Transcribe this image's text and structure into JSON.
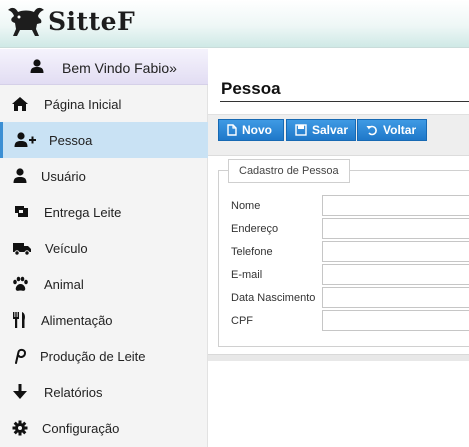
{
  "brand": {
    "name": "SitteF"
  },
  "sidebar": {
    "welcome": "Bem Vindo Fabio»",
    "items": [
      {
        "label": "Página Inicial",
        "icon": "home-icon"
      },
      {
        "label": "Pessoa",
        "icon": "user-plus-icon",
        "active": true
      },
      {
        "label": "Usuário",
        "icon": "user-icon"
      },
      {
        "label": "Entrega Leite",
        "icon": "milk-delivery-icon"
      },
      {
        "label": "Veículo",
        "icon": "truck-icon"
      },
      {
        "label": "Animal",
        "icon": "paw-icon"
      },
      {
        "label": "Alimentação",
        "icon": "cutlery-icon"
      },
      {
        "label": "Produção de Leite",
        "icon": "pinterest-p-icon"
      },
      {
        "label": "Relatórios",
        "icon": "arrow-down-icon"
      },
      {
        "label": "Configuração",
        "icon": "gear-icon"
      }
    ]
  },
  "main": {
    "title": "Pessoa",
    "toolbar": {
      "novo": "Novo",
      "salvar": "Salvar",
      "voltar": "Voltar"
    },
    "form": {
      "legend": "Cadastro de Pessoa",
      "fields": [
        {
          "label": "Nome",
          "value": ""
        },
        {
          "label": "Endereço",
          "value": ""
        },
        {
          "label": "Telefone",
          "value": ""
        },
        {
          "label": "E-mail",
          "value": ""
        },
        {
          "label": "Data Nascimento",
          "value": ""
        },
        {
          "label": "CPF",
          "value": ""
        }
      ]
    }
  },
  "colors": {
    "accent": "#2b87d7",
    "active_nav": "#c9e2f4",
    "header_tint": "#cfe9e6"
  }
}
